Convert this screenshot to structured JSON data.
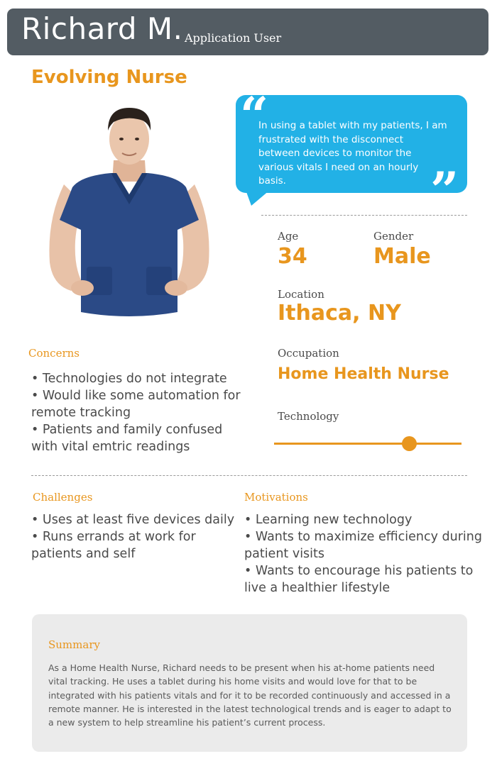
{
  "header": {
    "name": "Richard M.",
    "role": "Application User"
  },
  "persona_title": "Evolving Nurse",
  "quote": {
    "text": "In using a tablet with my patients, I am frustrated with the disconnect between devices to monitor the various vitals I need on an hourly basis."
  },
  "profile": {
    "age_label": "Age",
    "age_value": "34",
    "gender_label": "Gender",
    "gender_value": "Male",
    "location_label": "Location",
    "location_value": "Ithaca, NY",
    "occupation_label": "Occupation",
    "occupation_value": "Home Health Nurse",
    "technology_label": "Technology",
    "technology_level": 0.72
  },
  "concerns": {
    "title": "Concerns",
    "items": [
      "•  Technologies do not integrate",
      "• Would like some automation for remote tracking",
      "•  Patients and family confused with vital emtric readings"
    ]
  },
  "challenges": {
    "title": "Challenges",
    "items": [
      "• Uses at least five devices daily",
      "• Runs errands at work for patients and self"
    ]
  },
  "motivations": {
    "title": "Motivations",
    "items": [
      "• Learning new technology",
      "• Wants to maximize efficiency during patient visits",
      "•  Wants to encourage his patients to live a healthier lifestyle"
    ]
  },
  "summary": {
    "title": "Summary",
    "text": "As a Home Health Nurse, Richard needs to be present when his at-home patients need vital tracking.  He uses a tablet during his home visits and would love for that to be integrated with his patients vitals and for it to be recorded continuously and accessed in a remote manner.  He is interested in the latest technological trends and is eager to adapt to a new system to help streamline his patient’s current process."
  },
  "colors": {
    "header_bg": "#535c63",
    "accent_orange": "#e8961e",
    "quote_blue": "#22b1e6",
    "summary_bg": "#ebebeb"
  }
}
